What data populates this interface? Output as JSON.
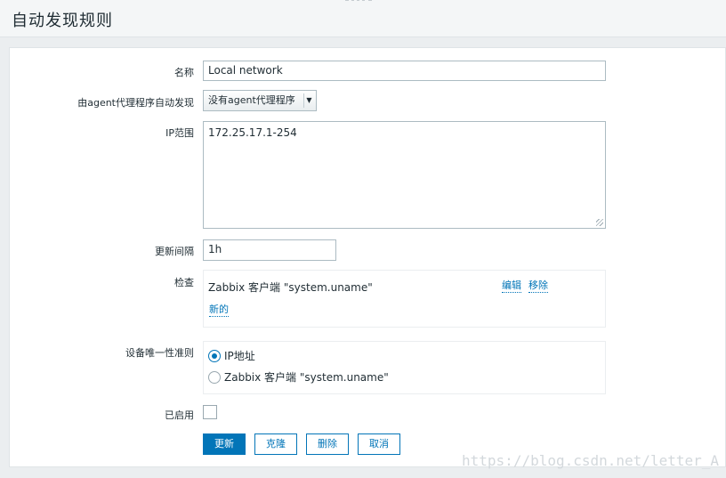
{
  "page": {
    "title": "自动发现规则"
  },
  "form": {
    "name_label": "名称",
    "name_value": "Local network",
    "proxy_label": "由agent代理程序自动发现",
    "proxy_value": "没有agent代理程序",
    "ip_range_label": "IP范围",
    "ip_range_value": "172.25.17.1-254",
    "interval_label": "更新间隔",
    "interval_value": "1h",
    "checks_label": "检查",
    "checks": [
      {
        "text": "Zabbix 客户端 \"system.uname\"",
        "edit": "编辑",
        "remove": "移除"
      }
    ],
    "checks_new": "新的",
    "uniqueness_label": "设备唯一性准则",
    "uniqueness_options": [
      {
        "label": "IP地址",
        "selected": true
      },
      {
        "label": "Zabbix 客户端 \"system.uname\"",
        "selected": false
      }
    ],
    "enabled_label": "已启用",
    "enabled": false
  },
  "buttons": {
    "update": "更新",
    "clone": "克隆",
    "delete": "删除",
    "cancel": "取消"
  },
  "watermark": "https://blog.csdn.net/letter_A",
  "colors": {
    "accent": "#0275b8",
    "background": "#ebeef0"
  }
}
